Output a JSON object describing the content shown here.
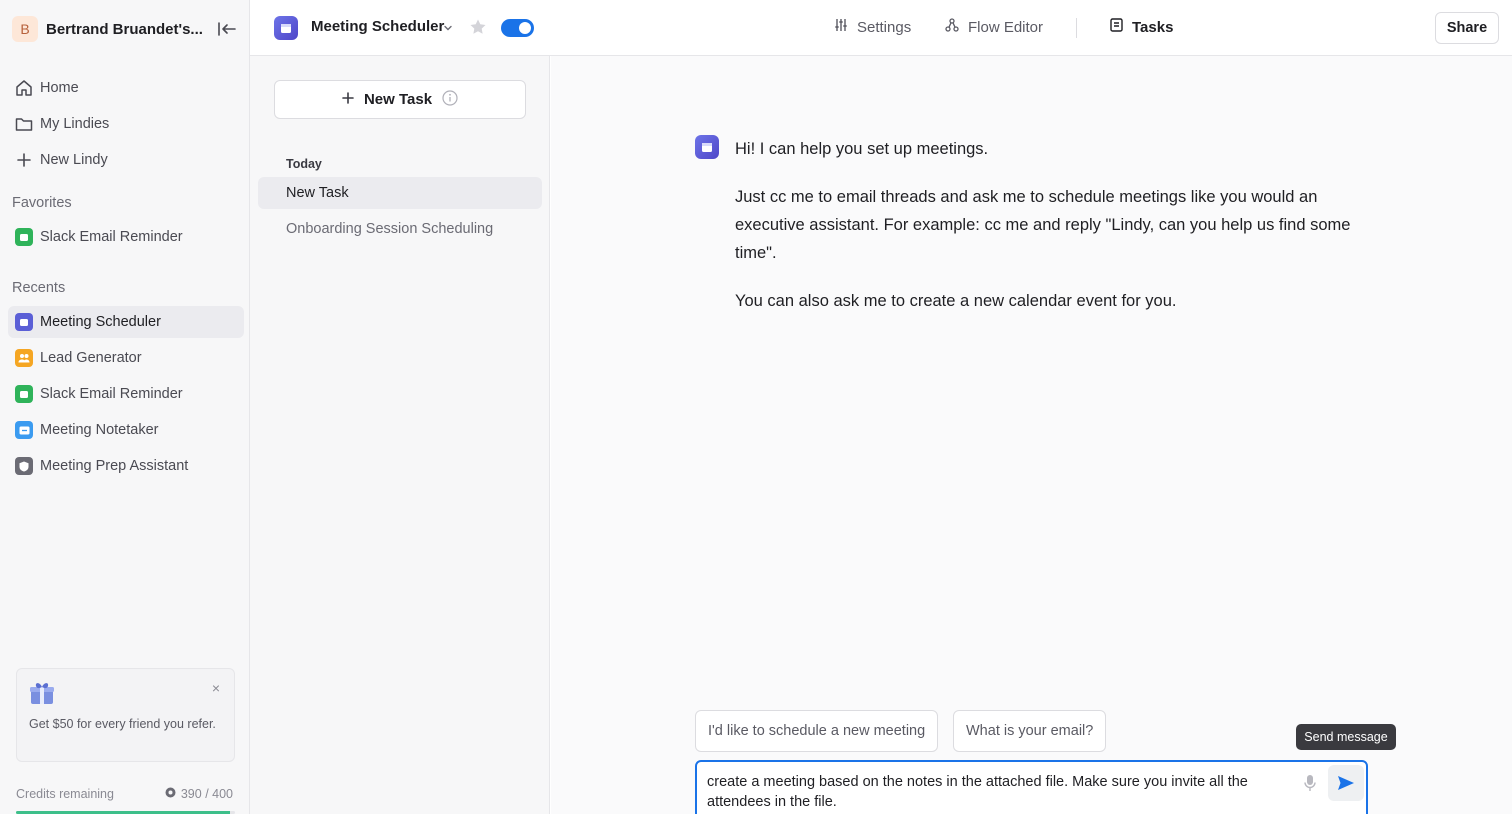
{
  "workspace": {
    "avatar_letter": "B",
    "name": "Bertrand Bruandet's..."
  },
  "nav": {
    "home": "Home",
    "my_lindies": "My Lindies",
    "new_lindy": "New Lindy"
  },
  "favorites": {
    "label": "Favorites",
    "items": [
      {
        "label": "Slack Email Reminder",
        "color": "#2fb35a"
      }
    ]
  },
  "recents": {
    "label": "Recents",
    "items": [
      {
        "label": "Meeting Scheduler",
        "color": "#5b5fd6",
        "active": true
      },
      {
        "label": "Lead Generator",
        "color": "#f5a623"
      },
      {
        "label": "Slack Email Reminder",
        "color": "#2fb35a"
      },
      {
        "label": "Meeting Notetaker",
        "color": "#3b9bf0"
      },
      {
        "label": "Meeting Prep Assistant",
        "color": "#6b6b74"
      }
    ]
  },
  "promo": {
    "text": "Get $50 for every friend you refer.",
    "close": "×"
  },
  "credits": {
    "label": "Credits remaining",
    "value": "390 / 400",
    "fraction": 0.975
  },
  "header": {
    "agent_name": "Meeting Scheduler",
    "tabs": {
      "settings": "Settings",
      "flow_editor": "Flow Editor",
      "tasks": "Tasks"
    },
    "share": "Share",
    "enabled": true
  },
  "tasks_pane": {
    "new_task": "New Task",
    "group_label": "Today",
    "items": [
      {
        "label": "New Task",
        "active": true
      },
      {
        "label": "Onboarding Session Scheduling"
      }
    ]
  },
  "chat": {
    "messages": [
      "Hi! I can help you set up meetings.",
      "Just cc me to email threads and ask me to schedule meetings like you would an executive assistant. For example: cc me and reply \"Lindy, can you help us find some time\".",
      "You can also ask me to create a new calendar event for you."
    ],
    "suggestions": [
      "I'd like to schedule a new meeting",
      "What is your email?"
    ],
    "tooltip": "Send message",
    "composer_text": "create a meeting based on the notes in the attached file. Make sure you invite all the attendees in the file."
  },
  "colors": {
    "accent": "#1a73e8",
    "agent": "#5b5fd6"
  }
}
